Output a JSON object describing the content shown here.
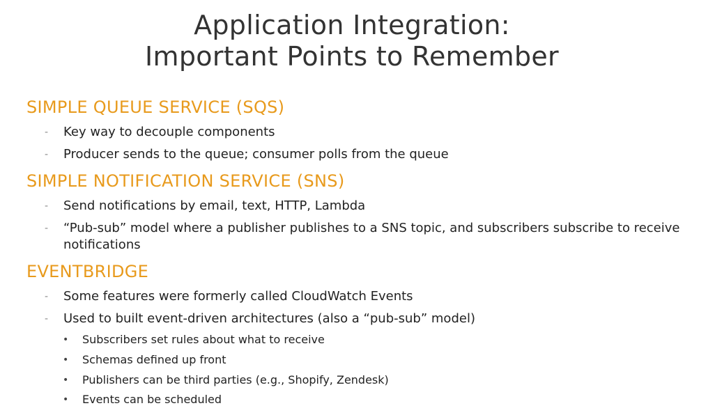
{
  "slide": {
    "title_line1": "Application Integration:",
    "title_line2": "Important Points to Remember"
  },
  "sections": [
    {
      "heading": "SIMPLE QUEUE SERVICE (SQS)",
      "items": [
        "Key way to decouple components",
        "Producer sends to the queue; consumer polls from the queue"
      ]
    },
    {
      "heading": "SIMPLE NOTIFICATION SERVICE (SNS)",
      "items": [
        "Send notifications by email, text, HTTP, Lambda",
        "“Pub-sub” model where a publisher publishes to a SNS topic, and subscribers subscribe to receive notifications"
      ]
    },
    {
      "heading": "EVENTBRIDGE",
      "items": [
        "Some features were formerly called CloudWatch Events",
        "Used to built event-driven architectures (also a “pub-sub” model)"
      ],
      "subitems": [
        "Subscribers set rules about what to receive",
        "Schemas defined up front",
        "Publishers can be third parties (e.g., Shopify, Zendesk)",
        "Events can be scheduled"
      ]
    }
  ],
  "markers": {
    "dash": "-",
    "bullet": "•"
  },
  "colors": {
    "heading_accent": "#e89a1c",
    "title_text": "#333333",
    "body_text": "#222222"
  }
}
